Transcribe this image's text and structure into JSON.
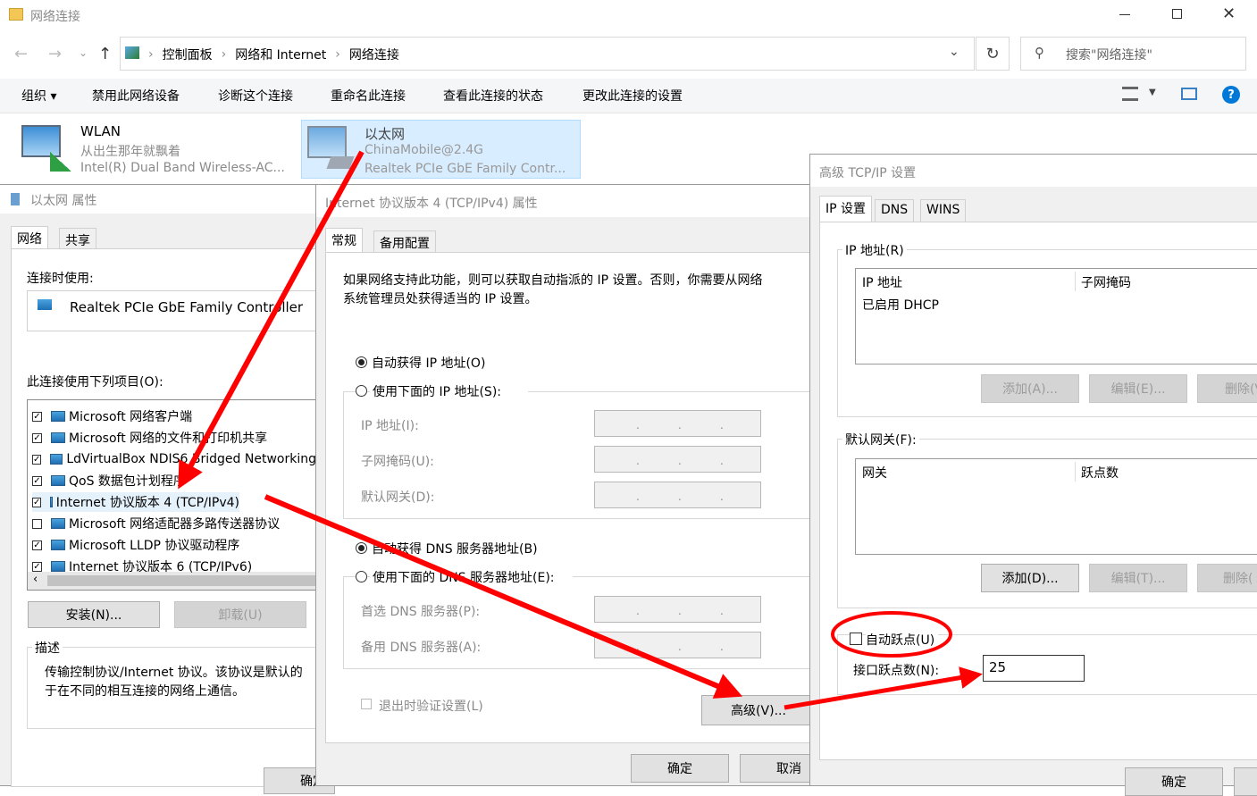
{
  "window": {
    "title": "网络连接"
  },
  "address": {
    "crumbs": [
      "控制面板",
      "网络和 Internet",
      "网络连接"
    ],
    "search_placeholder": "搜索\"网络连接\""
  },
  "toolbar": {
    "organize": "组织 ▾",
    "disable": "禁用此网络设备",
    "diagnose": "诊断这个连接",
    "rename": "重命名此连接",
    "status": "查看此连接的状态",
    "change": "更改此连接的设置"
  },
  "connections": [
    {
      "name": "WLAN",
      "network": "从出生那年就飘着",
      "adapter": "Intel(R) Dual Band Wireless-AC..."
    },
    {
      "name": "以太网",
      "network": "ChinaMobile@2.4G",
      "adapter": "Realtek PCIe GbE Family Contr..."
    }
  ],
  "eth_props": {
    "title": "以太网 属性",
    "tabs": [
      "网络",
      "共享"
    ],
    "connect_using_label": "连接时使用:",
    "adapter": "Realtek PCIe GbE Family Controller",
    "items_label": "此连接使用下列项目(O):",
    "items": [
      {
        "label": "Microsoft 网络客户端",
        "checked": true
      },
      {
        "label": "Microsoft 网络的文件和打印机共享",
        "checked": true
      },
      {
        "label": "LdVirtualBox NDIS6 Bridged Networking",
        "checked": true
      },
      {
        "label": "QoS 数据包计划程序",
        "checked": true
      },
      {
        "label": "Internet 协议版本 4 (TCP/IPv4)",
        "checked": true
      },
      {
        "label": "Microsoft 网络适配器多路传送器协议",
        "checked": false
      },
      {
        "label": "Microsoft LLDP 协议驱动程序",
        "checked": true
      },
      {
        "label": "Internet 协议版本 6 (TCP/IPv6)",
        "checked": true
      }
    ],
    "install": "安装(N)...",
    "uninstall": "卸载(U)",
    "desc_label": "描述",
    "desc_text": "传输控制协议/Internet 协议。该协议是默认的",
    "desc_text2": "于在不同的相互连接的网络上通信。",
    "ok": "确定"
  },
  "ipv4": {
    "title": "Internet 协议版本 4 (TCP/IPv4) 属性",
    "tabs": [
      "常规",
      "备用配置"
    ],
    "intro1": "如果网络支持此功能，则可以获取自动指派的 IP 设置。否则，你需要从网络",
    "intro2": "系统管理员处获得适当的 IP 设置。",
    "auto_ip": "自动获得 IP 地址(O)",
    "manual_ip": "使用下面的 IP 地址(S):",
    "ip_label": "IP 地址(I):",
    "mask_label": "子网掩码(U):",
    "gw_label": "默认网关(D):",
    "auto_dns": "自动获得 DNS 服务器地址(B)",
    "manual_dns": "使用下面的 DNS 服务器地址(E):",
    "pref_dns": "首选 DNS 服务器(P):",
    "alt_dns": "备用 DNS 服务器(A):",
    "validate": "退出时验证设置(L)",
    "advanced": "高级(V)...",
    "ok": "确定",
    "cancel": "取消"
  },
  "adv": {
    "title": "高级 TCP/IP 设置",
    "tabs": [
      "IP 设置",
      "DNS",
      "WINS"
    ],
    "ip_group": "IP 地址(R)",
    "ip_col1": "IP 地址",
    "ip_col2": "子网掩码",
    "ip_row": "已启用 DHCP",
    "add_a": "添加(A)...",
    "edit_e": "编辑(E)...",
    "del1": "删除(V",
    "gw_group": "默认网关(F):",
    "gw_col1": "网关",
    "gw_col2": "跃点数",
    "add_d": "添加(D)...",
    "edit_t": "编辑(T)...",
    "del2": "删除(",
    "auto_metric": "自动跃点(U)",
    "metric_label": "接口跃点数(N):",
    "metric_value": "25",
    "ok": "确定"
  },
  "colors": {
    "accent": "#0078d7",
    "annotation": "#ff0000"
  }
}
